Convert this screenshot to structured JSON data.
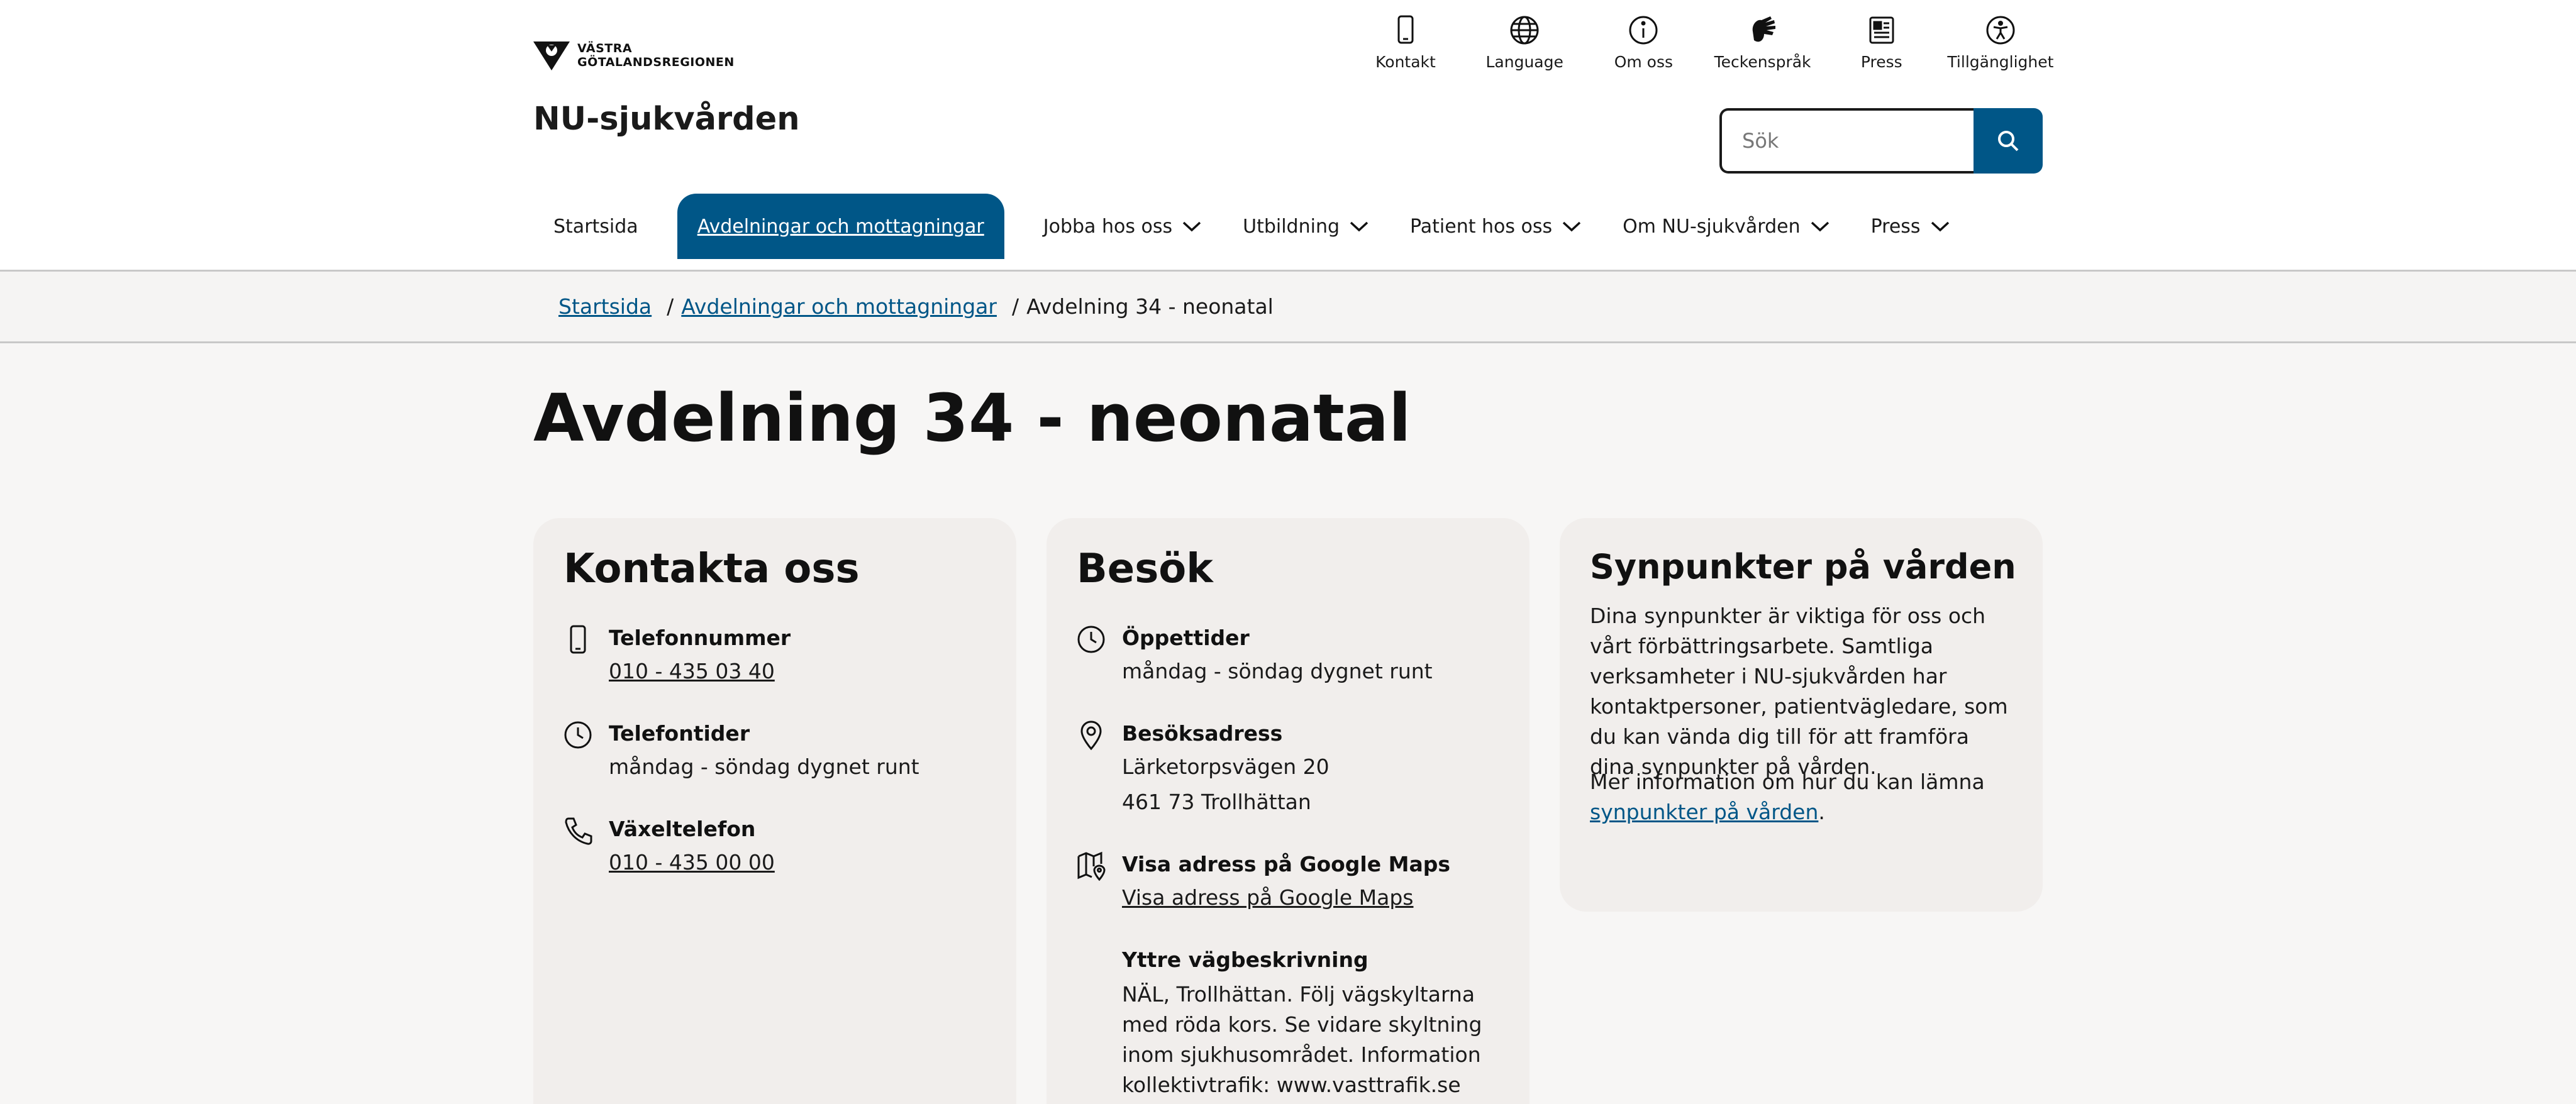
{
  "header": {
    "logo_line1": "VÄSTRA",
    "logo_line2": "GÖTALANDSREGIONEN",
    "site_title": "NU-sjukvården",
    "utility": [
      {
        "label": "Kontakt",
        "icon": "phone-icon"
      },
      {
        "label": "Language",
        "icon": "globe-icon"
      },
      {
        "label": "Om oss",
        "icon": "info-icon"
      },
      {
        "label": "Teckenspråk",
        "icon": "sign-language-icon"
      },
      {
        "label": "Press",
        "icon": "newspaper-icon"
      },
      {
        "label": "Tillgänglighet",
        "icon": "accessibility-icon"
      }
    ],
    "search_placeholder": "Sök"
  },
  "nav": [
    {
      "label": "Startsida",
      "dropdown": false,
      "active": false
    },
    {
      "label": "Avdelningar och mottagningar",
      "dropdown": false,
      "active": true
    },
    {
      "label": "Jobba hos oss",
      "dropdown": true,
      "active": false
    },
    {
      "label": "Utbildning",
      "dropdown": true,
      "active": false
    },
    {
      "label": "Patient hos oss",
      "dropdown": true,
      "active": false
    },
    {
      "label": "Om NU-sjukvården",
      "dropdown": true,
      "active": false
    },
    {
      "label": "Press",
      "dropdown": true,
      "active": false
    }
  ],
  "breadcrumb": {
    "home": "Startsida",
    "section": "Avdelningar och mottagningar",
    "separator": "/",
    "current": "Avdelning 34 - neonatal"
  },
  "page_title": "Avdelning 34 - neonatal",
  "contact": {
    "title": "Kontakta oss",
    "phone_label": "Telefonnummer",
    "phone_value": "010 - 435 03 40",
    "hours_label": "Telefontider",
    "hours_value": "måndag - söndag dygnet runt",
    "switchboard_label": "Växeltelefon",
    "switchboard_value": "010 - 435 00 00"
  },
  "visit": {
    "title": "Besök",
    "opening_label": "Öppettider",
    "opening_value": "måndag - söndag dygnet runt",
    "address_label": "Besöksadress",
    "address_line1": "Lärketorpsvägen 20",
    "address_line2": "461 73 Trollhättan",
    "maps_label": "Visa adress på Google Maps",
    "maps_link": "Visa adress på Google Maps",
    "directions_label": "Yttre vägbeskrivning",
    "directions_text": "NÄL, Trollhättan. Följ vägskyltarna med röda kors. Se vidare skyltning inom sjukhusområdet. Information kollektivtrafik: www.vasttrafik.se"
  },
  "feedback": {
    "title": "Synpunkter på vården",
    "paragraph1": "Dina synpunkter är viktiga för oss och vårt förbättringsarbete. Samtliga verksamheter i NU-sjukvården har kontaktpersoner, patientvägledare, som du kan vända dig till för att framföra dina synpunkter på vården.",
    "paragraph2_prefix": "Mer information om hur du kan lämna",
    "paragraph2_link": "synpunkter på vården",
    "paragraph2_suffix": "."
  },
  "colors": {
    "brand_blue": "#005687",
    "card_bg": "#f1eeec",
    "page_bg": "#f7f6f5"
  }
}
